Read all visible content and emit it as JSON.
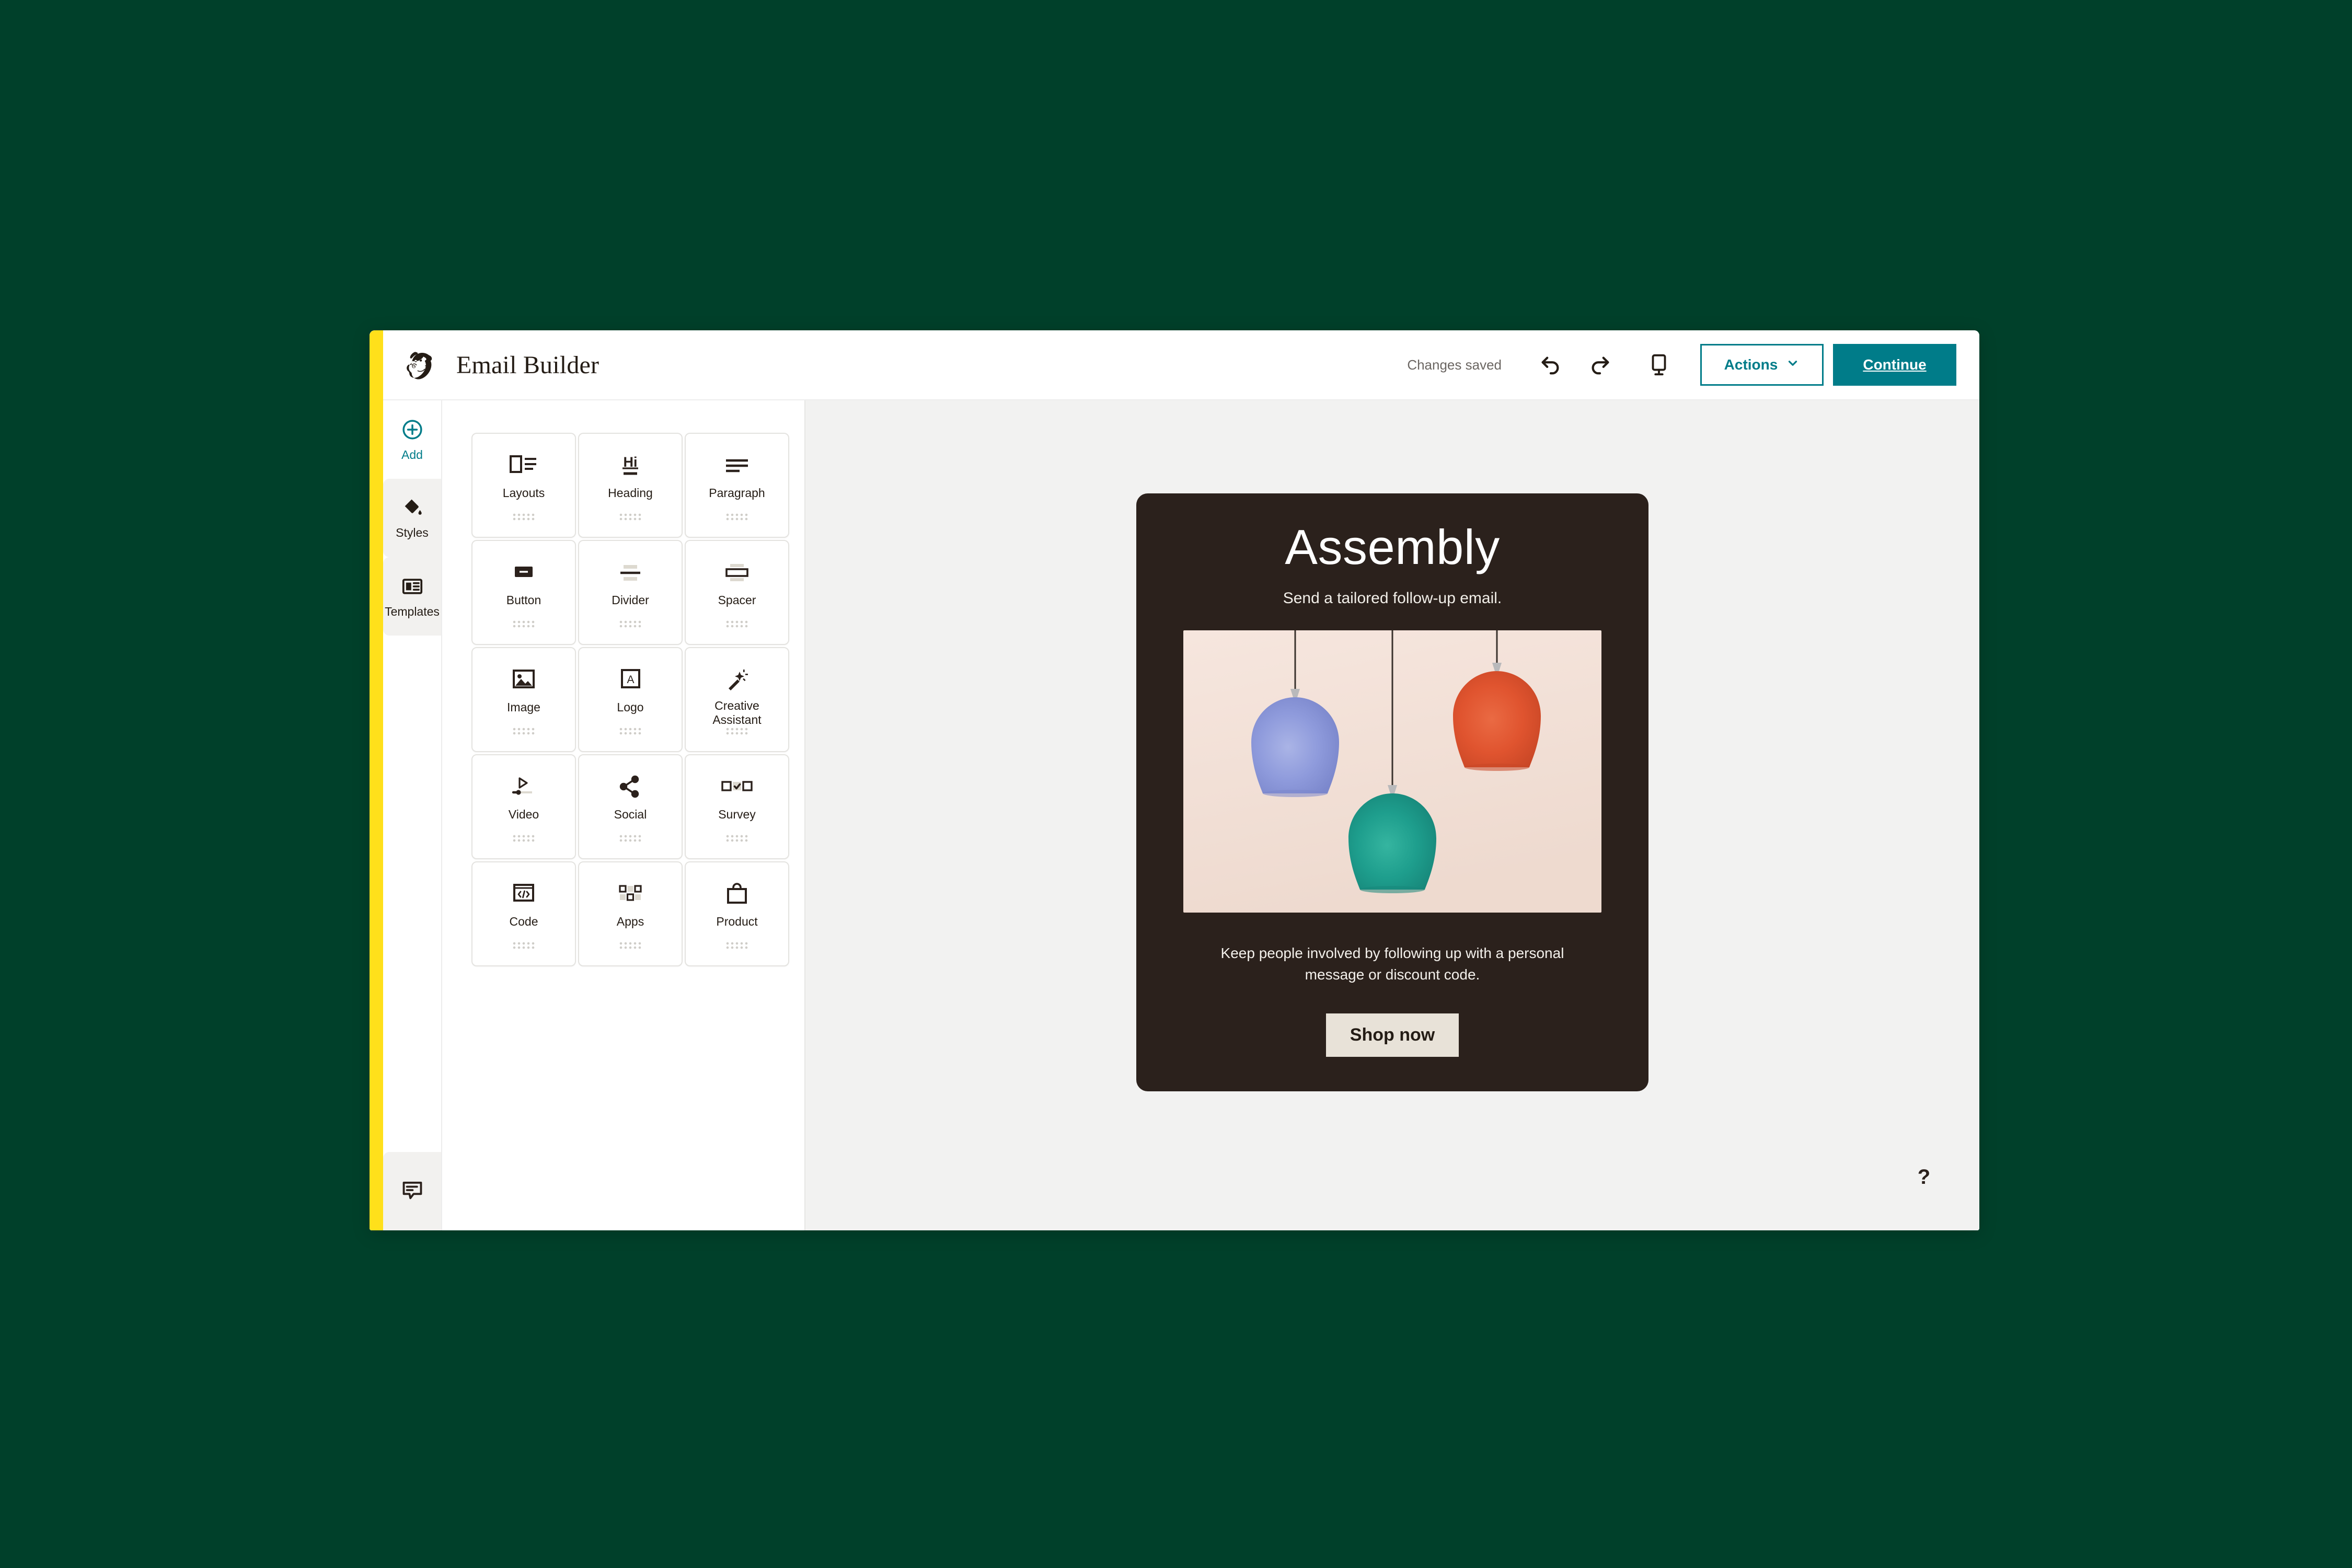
{
  "theme": {
    "page_background": "#00402a",
    "accent_yellow": "#ffe01b",
    "teal": "#007c89",
    "canvas_background": "#f2f2f1",
    "email_background": "#2b211c",
    "email_button_background": "#e8e2d8"
  },
  "header": {
    "title": "Email Builder",
    "logo_icon": "mailchimp-freddie-logo",
    "status_text": "Changes saved",
    "undo_icon": "undo-arrow-icon",
    "redo_icon": "redo-arrow-icon",
    "preview_icon": "desktop-preview-icon",
    "actions_label": "Actions",
    "actions_caret_icon": "chevron-down-icon",
    "continue_label": "Continue"
  },
  "rail": {
    "items": [
      {
        "label": "Add",
        "icon": "plus-circle-icon",
        "active": true
      },
      {
        "label": "Styles",
        "icon": "paint-bucket-icon",
        "active": false
      },
      {
        "label": "Templates",
        "icon": "templates-layout-icon",
        "active": false
      }
    ],
    "feedback_icon": "speech-bubble-icon"
  },
  "blocks": {
    "items": [
      {
        "label": "Layouts",
        "icon": "layouts-icon"
      },
      {
        "label": "Heading",
        "icon": "heading-hi-icon"
      },
      {
        "label": "Paragraph",
        "icon": "paragraph-lines-icon"
      },
      {
        "label": "Button",
        "icon": "button-icon"
      },
      {
        "label": "Divider",
        "icon": "divider-icon"
      },
      {
        "label": "Spacer",
        "icon": "spacer-icon"
      },
      {
        "label": "Image",
        "icon": "image-icon"
      },
      {
        "label": "Logo",
        "icon": "logo-a-icon"
      },
      {
        "label": "Creative Assistant",
        "icon": "magic-wand-icon"
      },
      {
        "label": "Video",
        "icon": "video-play-icon"
      },
      {
        "label": "Social",
        "icon": "social-share-icon"
      },
      {
        "label": "Survey",
        "icon": "survey-checkbox-icon"
      },
      {
        "label": "Code",
        "icon": "code-brackets-icon"
      },
      {
        "label": "Apps",
        "icon": "apps-grid-icon"
      },
      {
        "label": "Product",
        "icon": "shopping-bag-icon"
      }
    ],
    "drag_handle_icon": "drag-dots-icon"
  },
  "email": {
    "heading": "Assembly",
    "subheading": "Send a tailored follow-up email.",
    "hero_image_alt": "three-pendant-lamps-photo",
    "hero_colors": {
      "background": "#f2e1d9",
      "lamp_blue": "#8d9ada",
      "lamp_teal": "#1e9e8d",
      "lamp_orange": "#e0542f"
    },
    "body_text": "Keep people involved by following up with a personal message or discount code.",
    "cta_label": "Shop now"
  },
  "canvas": {
    "help_label": "?"
  }
}
